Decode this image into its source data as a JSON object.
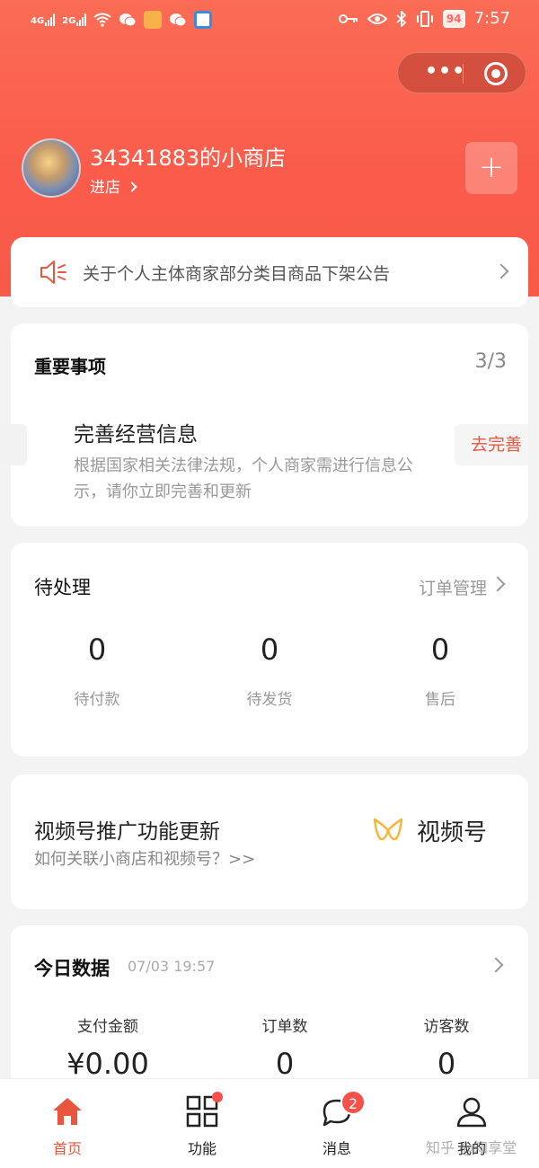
{
  "status_bar": {
    "signal1": "4G",
    "signal2": "2G",
    "battery": "94",
    "time": "7:57"
  },
  "shop": {
    "name": "34341883的小商店",
    "enter_label": "进店"
  },
  "notice": {
    "text": "关于个人主体商家部分类目商品下架公告"
  },
  "important": {
    "title": "重要事项",
    "count": "3/3",
    "item_title": "完善经营信息",
    "item_desc": "根据国家相关法律法规，个人商家需进行信息公示，请你立即完善和更新",
    "action_label": "去完善"
  },
  "pending": {
    "title": "待处理",
    "link_label": "订单管理",
    "stats": [
      {
        "value": "0",
        "label": "待付款"
      },
      {
        "value": "0",
        "label": "待发货"
      },
      {
        "value": "0",
        "label": "售后"
      }
    ]
  },
  "video": {
    "title": "视频号推广功能更新",
    "subtitle": "如何关联小商店和视频号？>>",
    "brand": "视频号"
  },
  "today": {
    "title": "今日数据",
    "date": "07/03 19:57",
    "stats": [
      {
        "label": "支付金额",
        "value": "¥0.00"
      },
      {
        "label": "订单数",
        "value": "0"
      },
      {
        "label": "访客数",
        "value": "0"
      }
    ]
  },
  "tabbar": {
    "items": [
      {
        "label": "首页"
      },
      {
        "label": "功能"
      },
      {
        "label": "消息",
        "badge": "2"
      },
      {
        "label": "我的"
      }
    ]
  },
  "watermark": "知乎 @知享堂",
  "colors": {
    "accent": "#e8563f",
    "header": "#fa5b4a"
  }
}
